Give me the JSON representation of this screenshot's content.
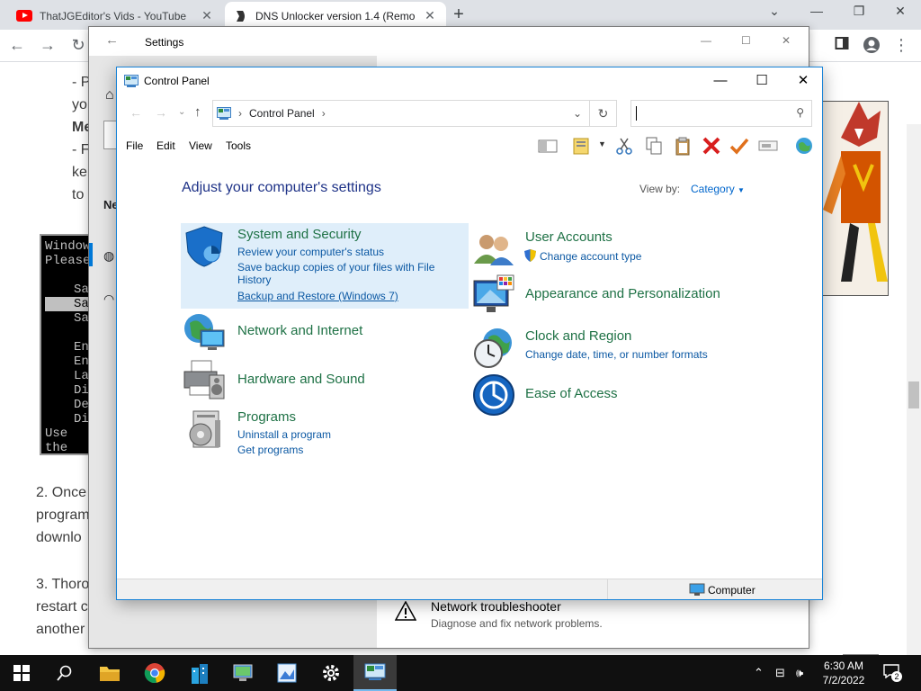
{
  "browser": {
    "tabs": [
      {
        "title": "ThatJGEditor's Vids - YouTube",
        "active": false
      },
      {
        "title": "DNS Unlocker version 1.4 (Remo",
        "active": true
      }
    ]
  },
  "article": {
    "lines": [
      "- P",
      "yo",
      "Me",
      "- F",
      "ke",
      "to"
    ],
    "dos_lines": [
      "Windows",
      "Please",
      "",
      "Sa",
      "Sa",
      "Sa",
      "",
      "En",
      "En",
      "La",
      "Di",
      "De",
      "Di",
      "Use the"
    ],
    "para2": [
      "2. Once",
      "program",
      "downlo"
    ],
    "para3": [
      "3. Thoro",
      "restart c",
      "another"
    ]
  },
  "settings": {
    "title": "Settings",
    "troubleshooter_title": "Network troubleshooter",
    "troubleshooter_desc": "Diagnose and fix network problems."
  },
  "control_panel": {
    "title": "Control Panel",
    "breadcrumb": "Control Panel",
    "menu": [
      "File",
      "Edit",
      "View",
      "Tools"
    ],
    "heading": "Adjust your computer's settings",
    "view_by_label": "View by:",
    "view_by_value": "Category",
    "categories_left": [
      {
        "title": "System and Security",
        "links": [
          "Review your computer's status",
          "Save backup copies of your files with File History",
          "Backup and Restore (Windows 7)"
        ]
      },
      {
        "title": "Network and Internet",
        "links": []
      },
      {
        "title": "Hardware and Sound",
        "links": []
      },
      {
        "title": "Programs",
        "links": [
          "Uninstall a program",
          "Get programs"
        ]
      }
    ],
    "categories_right": [
      {
        "title": "User Accounts",
        "links": [
          "Change account type"
        ]
      },
      {
        "title": "Appearance and Personalization",
        "links": []
      },
      {
        "title": "Clock and Region",
        "links": [
          "Change date, time, or number formats"
        ]
      },
      {
        "title": "Ease of Access",
        "links": []
      }
    ],
    "status_bar": "Computer"
  },
  "taskbar": {
    "time": "6:30 AM",
    "date": "7/2/2022",
    "notification_count": "2"
  }
}
